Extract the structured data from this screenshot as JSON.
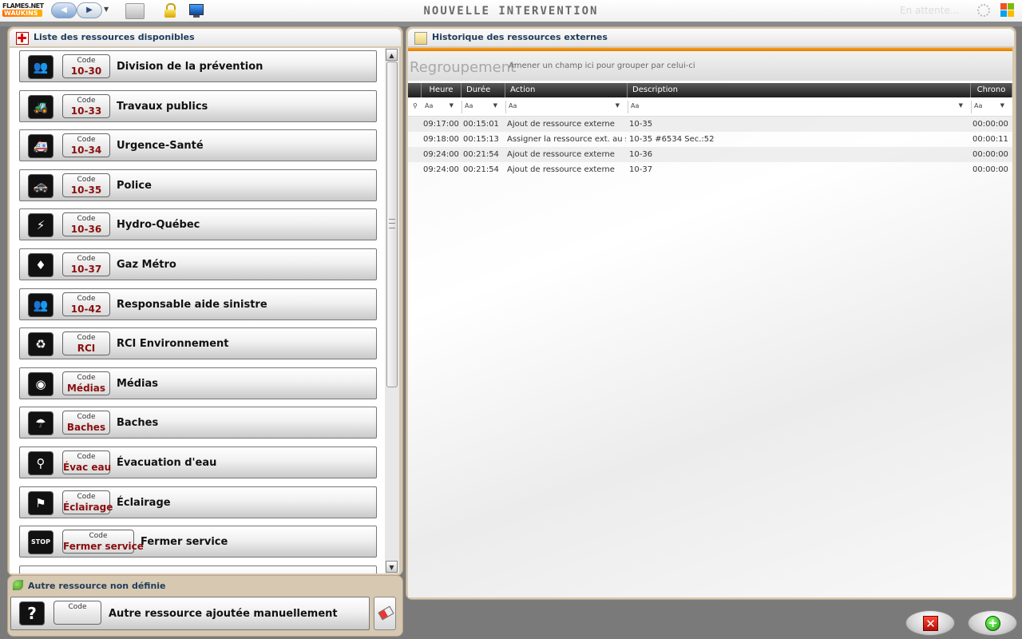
{
  "topbar": {
    "logo_line1": "FLAMES.NET",
    "logo_line2": "WAUKINS",
    "app_title": "NOUVELLE INTERVENTION",
    "status": "En attente..."
  },
  "left_panel": {
    "title": "Liste des ressources disponibles",
    "code_label": "Code",
    "items": [
      {
        "code": "10-30",
        "name": "Division de la prévention",
        "icon": "group-icon",
        "glyph": "👥"
      },
      {
        "code": "10-33",
        "name": "Travaux publics",
        "icon": "bulldozer-icon",
        "glyph": "🚜"
      },
      {
        "code": "10-34",
        "name": "Urgence-Santé",
        "icon": "ambulance-icon",
        "glyph": "🚑"
      },
      {
        "code": "10-35",
        "name": "Police",
        "icon": "police-car-icon",
        "glyph": "🚓"
      },
      {
        "code": "10-36",
        "name": "Hydro-Québec",
        "icon": "lightning-icon",
        "glyph": "⚡"
      },
      {
        "code": "10-37",
        "name": "Gaz Métro",
        "icon": "flame-icon",
        "glyph": "♦"
      },
      {
        "code": "10-42",
        "name": "Responsable aide sinistre",
        "icon": "group-icon",
        "glyph": "👥"
      },
      {
        "code": "RCI",
        "name": "RCI Environnement",
        "icon": "recycle-icon",
        "glyph": "♻"
      },
      {
        "code": "Médias",
        "name": "Médias",
        "icon": "camera-icon",
        "glyph": "◉"
      },
      {
        "code": "Baches",
        "name": "Baches",
        "icon": "umbrella-icon",
        "glyph": "☂"
      },
      {
        "code": "Évac eau",
        "name": "Évacuation d'eau",
        "icon": "faucet-icon",
        "glyph": "⚲"
      },
      {
        "code": "Éclairage",
        "name": "Éclairage",
        "icon": "lamp-icon",
        "glyph": "⚑"
      },
      {
        "code": "Fermer service",
        "name": "Fermer service",
        "icon": "stop-sign-icon",
        "glyph": "STOP"
      }
    ]
  },
  "other_panel": {
    "title": "Autre ressource non définie",
    "code_label": "Code",
    "item_name": "Autre ressource ajoutée manuellement",
    "icon_glyph": "?"
  },
  "right_panel": {
    "title": "Historique des ressources externes",
    "group_title": "Regroupement",
    "group_hint": "Amener un champ ici pour grouper par celui-ci",
    "filter_placeholder": "Aa",
    "columns": [
      "Heure",
      "Durée",
      "Action",
      "Description",
      "Chrono"
    ],
    "rows": [
      [
        "09:17:00",
        "00:15:01",
        "Ajout de ressource externe",
        "10-35",
        "00:00:00"
      ],
      [
        "09:18:00",
        "00:15:13",
        "Assigner la ressource ext. au secteur",
        "10-35  #6534  Sec.:52",
        "00:00:11"
      ],
      [
        "09:24:00",
        "00:21:54",
        "Ajout de ressource externe",
        "10-36",
        "00:00:00"
      ],
      [
        "09:24:00",
        "00:21:54",
        "Ajout de ressource externe",
        "10-37",
        "00:00:00"
      ]
    ]
  },
  "colors": {
    "panel_bg": "#d6c8b1",
    "code_text": "#8a0e0e",
    "accent_orange": "#f7a21b",
    "header_text": "#1f3b5a"
  }
}
